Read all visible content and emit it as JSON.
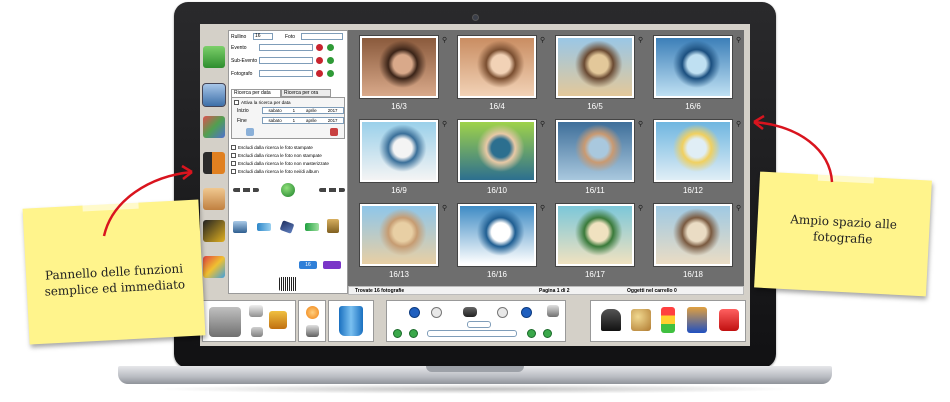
{
  "panel": {
    "rullino_label": "Rullino",
    "rullino_value": "16",
    "foto_label": "Foto",
    "evento_label": "Evento",
    "subevento_label": "Sub-Evento",
    "fotografo_label": "Fotografo",
    "tabs": [
      "Ricerca per data",
      "Ricerca per ora"
    ],
    "attiva_label": "Attiva la ricerca per data",
    "inizio_label": "Inizio",
    "fine_label": "Fine",
    "date_start": [
      "sabato",
      "1",
      "aprile",
      "2017"
    ],
    "date_end": [
      "sabato",
      "1",
      "aprile",
      "2017"
    ],
    "excludes": [
      "Escludi dalla ricerca le foto stampate",
      "Escludi dalla ricerca le foto non stampate",
      "Escludi dalla ricerca le foto non masterizzate",
      "Escludi dalla ricerca le foto nei/di album"
    ],
    "badge_value": "16"
  },
  "photos": [
    {
      "label": "16/3",
      "colors": [
        "#8a5a3c",
        "#d9a98a",
        "#3b2418"
      ]
    },
    {
      "label": "16/4",
      "colors": [
        "#c98d62",
        "#f2d2b6",
        "#7a4e30"
      ]
    },
    {
      "label": "16/5",
      "colors": [
        "#9ac7e6",
        "#e3c89a",
        "#6a4a32"
      ]
    },
    {
      "label": "16/6",
      "colors": [
        "#3c7fb8",
        "#bfe0f2",
        "#1b4f7f"
      ]
    },
    {
      "label": "16/9",
      "colors": [
        "#9ad0ea",
        "#f4f4f4",
        "#3a6f99"
      ]
    },
    {
      "label": "16/10",
      "colors": [
        "#9fd24a",
        "#2c6f8f",
        "#e8c9a6"
      ]
    },
    {
      "label": "16/11",
      "colors": [
        "#3f6f9a",
        "#a9c8de",
        "#c99a72"
      ]
    },
    {
      "label": "16/12",
      "colors": [
        "#6fb6e0",
        "#e0eef6",
        "#f0d060"
      ]
    },
    {
      "label": "16/13",
      "colors": [
        "#8ec6ea",
        "#e8cfa4",
        "#c69c72"
      ]
    },
    {
      "label": "16/16",
      "colors": [
        "#3e8bc4",
        "#ffffff",
        "#1f5e92"
      ]
    },
    {
      "label": "16/17",
      "colors": [
        "#7cc7d9",
        "#f0e2c0",
        "#3a7a3a"
      ]
    },
    {
      "label": "16/18",
      "colors": [
        "#9fc9e3",
        "#eadcc4",
        "#7a5a40"
      ]
    }
  ],
  "status": {
    "found": "Trovate 16 fotografie",
    "page": "Pagina 1 di 2",
    "cart": "Oggetti nel carrello 0"
  },
  "notes": {
    "left": "Pannello delle funzioni semplice ed immediato",
    "right": "Ampio spazio alle fotografie"
  },
  "colors": {
    "note": "#fff48c",
    "arrow": "#d9141e",
    "grid_bg": "#6e6e6e",
    "nav_button": "#1f5fbf"
  }
}
